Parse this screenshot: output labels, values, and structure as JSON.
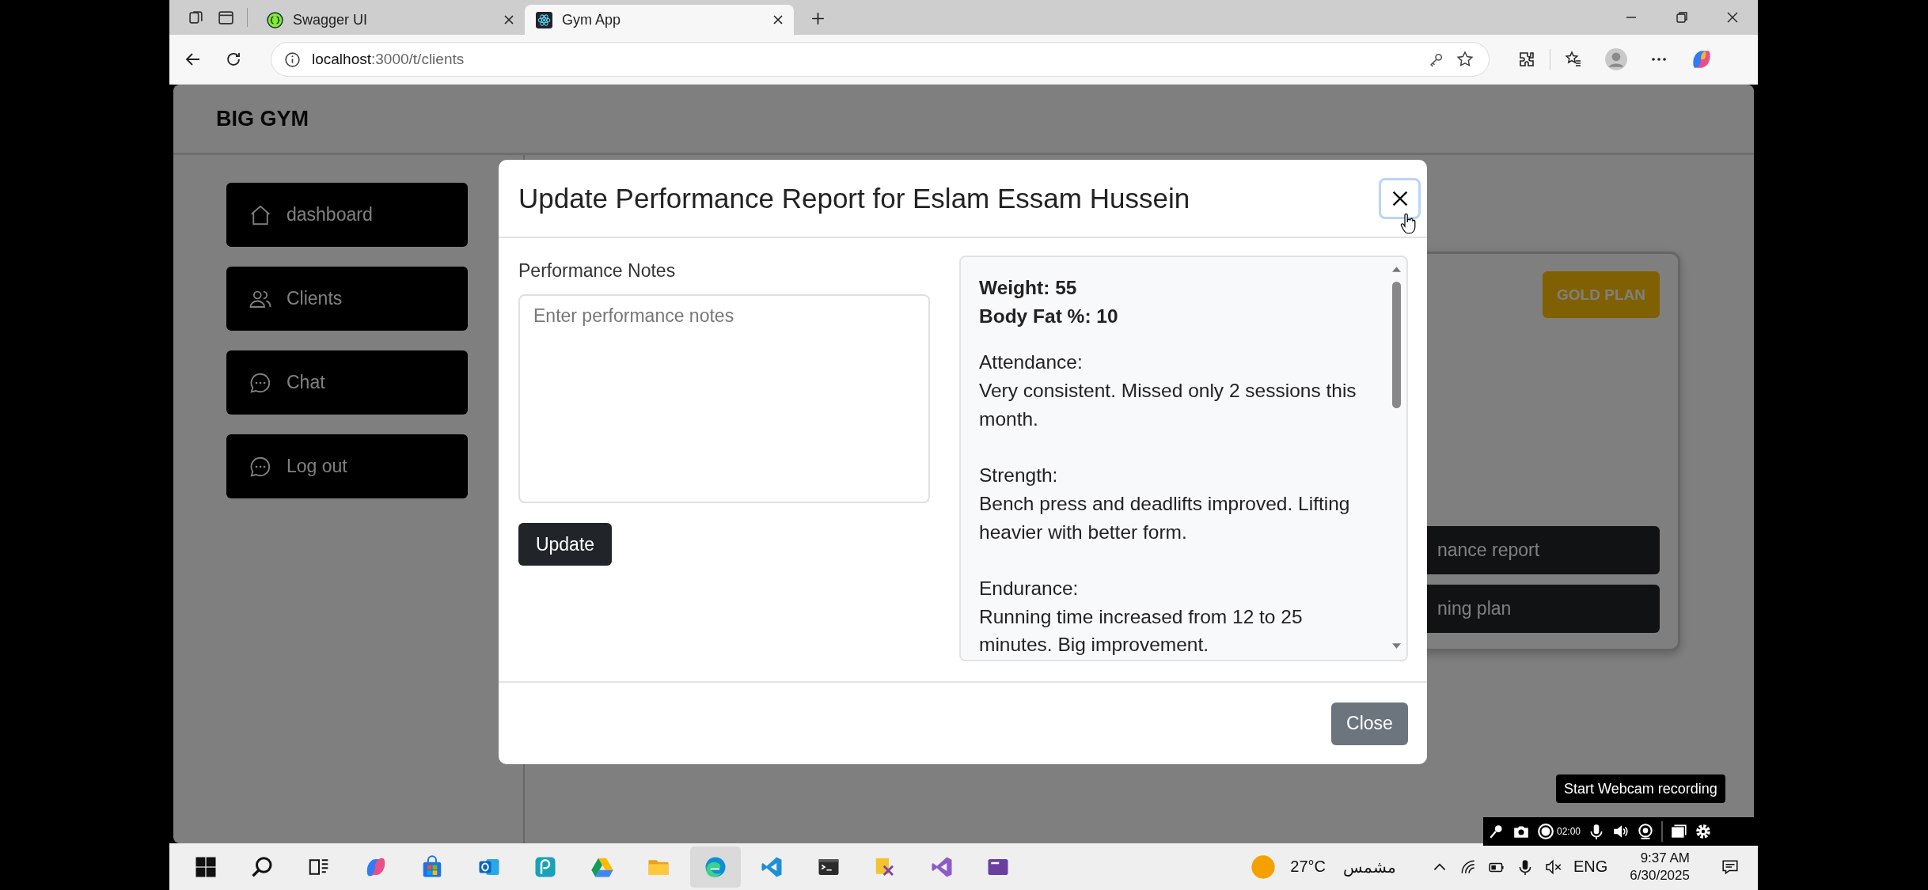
{
  "browser": {
    "tabs": [
      {
        "title": "Swagger UI",
        "kind": "swagger",
        "selected": false
      },
      {
        "title": "Gym App",
        "kind": "react",
        "selected": true
      }
    ],
    "address": {
      "host": "localhost",
      "path": ":3000/t/clients"
    }
  },
  "app": {
    "brand": "BIG GYM",
    "sidebar": [
      {
        "label": "dashboard",
        "kind": "home"
      },
      {
        "label": "Clients",
        "kind": "users"
      },
      {
        "label": "Chat",
        "kind": "chat"
      },
      {
        "label": "Log out",
        "kind": "chat"
      }
    ],
    "client_card": {
      "plan_badge": "GOLD PLAN",
      "actions": [
        "nance report",
        "ning plan"
      ]
    }
  },
  "modal": {
    "title": "Update Performance Report for Eslam Essam Hussein",
    "close_focused": true,
    "notes_label": "Performance Notes",
    "notes_placeholder": "Enter performance notes",
    "update_button": "Update",
    "stats": [
      "Weight: 55",
      "Body Fat %: 10"
    ],
    "sections": [
      {
        "heading": "Attendance:",
        "text": "Very consistent. Missed only 2 sessions this month."
      },
      {
        "heading": "Strength:",
        "text": "Bench press and deadlifts improved. Lifting heavier with better form."
      },
      {
        "heading": "Endurance:",
        "text": "Running time increased from 12 to 25 minutes. Big improvement."
      }
    ],
    "close_button": "Close"
  },
  "recorder": {
    "timer": "02:00",
    "tooltip": "Start Webcam recording"
  },
  "taskbar": {
    "apps": [
      {
        "kind": "start",
        "selected": false
      },
      {
        "kind": "search",
        "selected": false
      },
      {
        "kind": "taskview",
        "selected": false
      },
      {
        "kind": "copilot",
        "selected": false
      },
      {
        "kind": "store",
        "selected": false
      },
      {
        "kind": "outlook",
        "selected": false
      },
      {
        "kind": "pcloud",
        "selected": false
      },
      {
        "kind": "drive",
        "selected": false
      },
      {
        "kind": "folder",
        "selected": false
      },
      {
        "kind": "edge",
        "selected": true
      },
      {
        "kind": "vscode",
        "selected": false
      },
      {
        "kind": "terminal",
        "selected": false
      },
      {
        "kind": "xtool",
        "selected": false
      },
      {
        "kind": "studio",
        "selected": false
      },
      {
        "kind": "purple",
        "selected": false
      }
    ],
    "weather": {
      "temperature": "27°C",
      "condition": "مشمس"
    },
    "language": "ENG",
    "time": "9:37 AM",
    "date": "6/30/2025"
  }
}
